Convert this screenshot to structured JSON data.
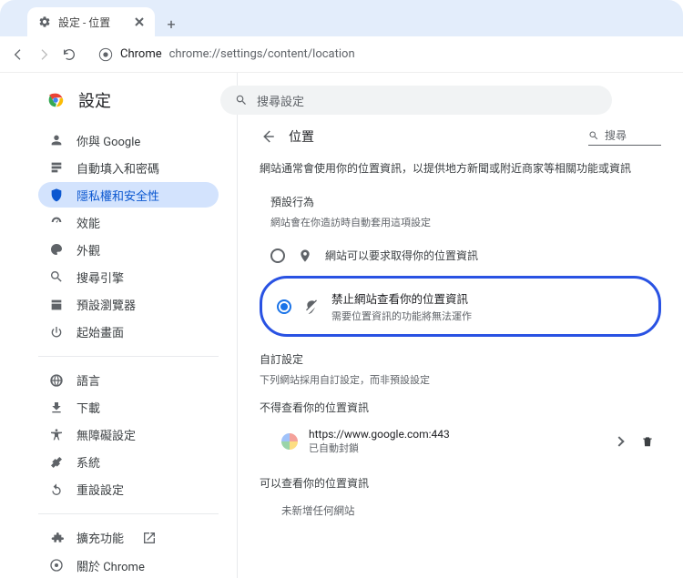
{
  "tab": {
    "title": "設定 - 位置"
  },
  "omnibox": {
    "host": "Chrome",
    "url": "chrome://settings/content/location"
  },
  "header": {
    "title": "設定",
    "search_placeholder": "搜尋設定"
  },
  "sidebar": {
    "items": [
      {
        "label": "你與 Google",
        "icon": "person"
      },
      {
        "label": "自動填入和密碼",
        "icon": "autofill"
      },
      {
        "label": "隱私權和安全性",
        "icon": "shield",
        "active": true
      },
      {
        "label": "效能",
        "icon": "speed"
      },
      {
        "label": "外觀",
        "icon": "palette"
      },
      {
        "label": "搜尋引擎",
        "icon": "search"
      },
      {
        "label": "預設瀏覽器",
        "icon": "browser"
      },
      {
        "label": "起始畫面",
        "icon": "power"
      }
    ],
    "items2": [
      {
        "label": "語言",
        "icon": "globe"
      },
      {
        "label": "下載",
        "icon": "download"
      },
      {
        "label": "無障礙設定",
        "icon": "a11y"
      },
      {
        "label": "系統",
        "icon": "system"
      },
      {
        "label": "重設設定",
        "icon": "reset"
      }
    ],
    "items3": [
      {
        "label": "擴充功能",
        "icon": "extension",
        "external": true
      },
      {
        "label": "關於 Chrome",
        "icon": "chrome"
      }
    ]
  },
  "main": {
    "section_title": "位置",
    "search_label": "搜尋",
    "description": "網站通常會使用你的位置資訊，以提供地方新聞或附近商家等相關功能或資訊",
    "default_heading": "預設行為",
    "default_desc": "網站會在你造訪時自動套用這項設定",
    "option_allow": "網站可以要求取得你的位置資訊",
    "option_block_title": "禁止網站查看你的位置資訊",
    "option_block_sub": "需要位置資訊的功能將無法運作",
    "custom_heading": "自訂設定",
    "custom_desc": "下列網站採用自訂設定，而非預設設定",
    "blocked_heading": "不得查看你的位置資訊",
    "site": {
      "url": "https://www.google.com:443",
      "status": "已自動封鎖"
    },
    "allowed_heading": "可以查看你的位置資訊",
    "allowed_empty": "未新增任何網站"
  }
}
